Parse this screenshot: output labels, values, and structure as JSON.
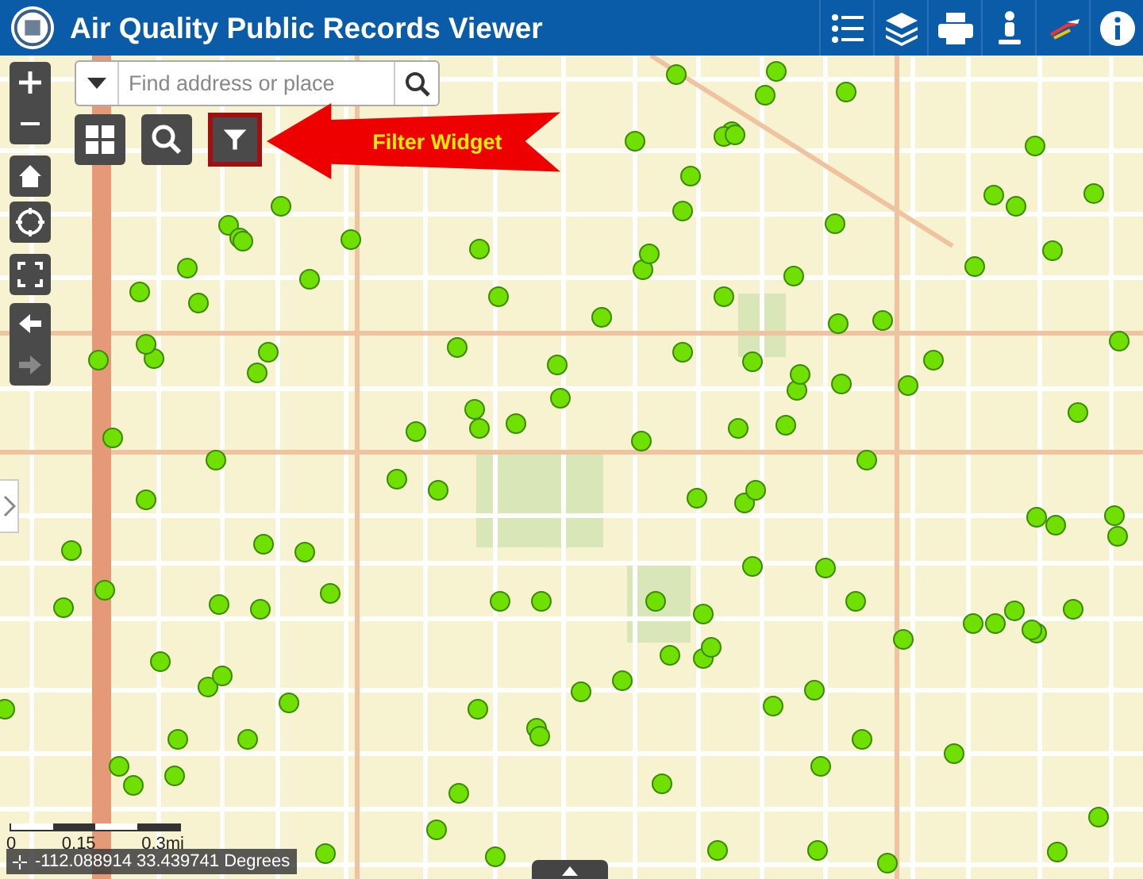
{
  "header": {
    "title": "Air Quality Public Records Viewer"
  },
  "search": {
    "placeholder": "Find address or place"
  },
  "callout": {
    "label": "Filter Widget"
  },
  "scale_bar": {
    "labels": [
      "0",
      "0.15",
      "0.3mi"
    ]
  },
  "coordinates": {
    "text": "-112.088914 33.439741 Degrees"
  }
}
